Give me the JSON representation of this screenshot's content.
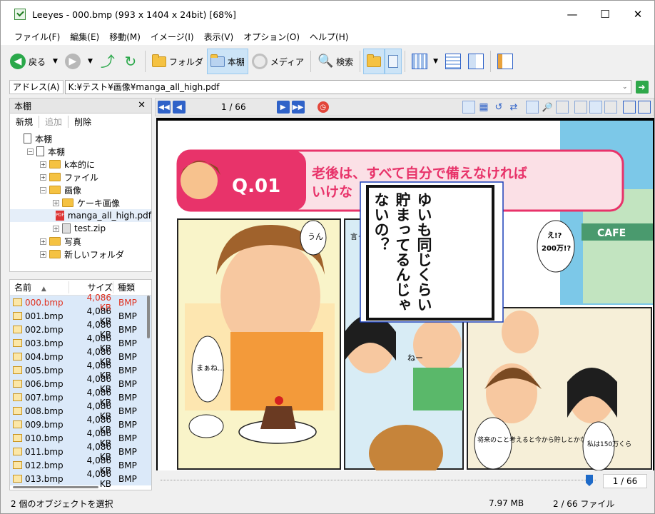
{
  "window": {
    "title": "Leeyes - 000.bmp (993 x 1404 x 24bit) [68%]"
  },
  "menu": [
    "ファイル(F)",
    "編集(E)",
    "移動(M)",
    "イメージ(I)",
    "表示(V)",
    "オプション(O)",
    "ヘルプ(H)"
  ],
  "toolbar": {
    "back": "戻る",
    "folder": "フォルダ",
    "bookshelf": "本棚",
    "media": "メディア",
    "search": "検索"
  },
  "address": {
    "label": "アドレス(A)",
    "value": "K:¥テスト¥画像¥manga_all_high.pdf"
  },
  "pane": {
    "title": "本棚",
    "btn_new": "新規",
    "btn_add": "追加",
    "btn_delete": "削除"
  },
  "tree": [
    {
      "label": "本棚",
      "icon": "doc",
      "indent": 0,
      "toggle": ""
    },
    {
      "label": "本棚",
      "icon": "doc",
      "indent": 1,
      "toggle": "−"
    },
    {
      "label": "k本的に",
      "icon": "folder",
      "indent": 2,
      "toggle": "+"
    },
    {
      "label": "ファイル",
      "icon": "folder",
      "indent": 2,
      "toggle": "+"
    },
    {
      "label": "画像",
      "icon": "folder",
      "indent": 2,
      "toggle": "−"
    },
    {
      "label": "ケーキ画像",
      "icon": "folder",
      "indent": 3,
      "toggle": "+"
    },
    {
      "label": "manga_all_high.pdf",
      "icon": "pdf",
      "indent": 3,
      "toggle": "",
      "selected": true
    },
    {
      "label": "test.zip",
      "icon": "zip",
      "indent": 3,
      "toggle": "+"
    },
    {
      "label": "写真",
      "icon": "folder",
      "indent": 2,
      "toggle": "+"
    },
    {
      "label": "新しいフォルダ",
      "icon": "folder",
      "indent": 2,
      "toggle": "+"
    }
  ],
  "filelist": {
    "headers": {
      "name": "名前",
      "size": "サイズ",
      "type": "種類"
    },
    "rows": [
      {
        "name": "000.bmp",
        "size": "4,086 KB",
        "type": "BMP",
        "current": true
      },
      {
        "name": "001.bmp",
        "size": "4,086 KB",
        "type": "BMP",
        "current": false
      },
      {
        "name": "002.bmp",
        "size": "4,086 KB",
        "type": "BMP",
        "current": false
      },
      {
        "name": "003.bmp",
        "size": "4,086 KB",
        "type": "BMP",
        "current": false
      },
      {
        "name": "004.bmp",
        "size": "4,086 KB",
        "type": "BMP",
        "current": false
      },
      {
        "name": "005.bmp",
        "size": "4,086 KB",
        "type": "BMP",
        "current": false
      },
      {
        "name": "006.bmp",
        "size": "4,086 KB",
        "type": "BMP",
        "current": false
      },
      {
        "name": "007.bmp",
        "size": "4,086 KB",
        "type": "BMP",
        "current": false
      },
      {
        "name": "008.bmp",
        "size": "4,086 KB",
        "type": "BMP",
        "current": false
      },
      {
        "name": "009.bmp",
        "size": "4,086 KB",
        "type": "BMP",
        "current": false
      },
      {
        "name": "010.bmp",
        "size": "4,086 KB",
        "type": "BMP",
        "current": false
      },
      {
        "name": "011.bmp",
        "size": "4,086 KB",
        "type": "BMP",
        "current": false
      },
      {
        "name": "012.bmp",
        "size": "4,086 KB",
        "type": "BMP",
        "current": false
      },
      {
        "name": "013.bmp",
        "size": "4,086 KB",
        "type": "BMP",
        "current": false
      }
    ]
  },
  "viewer": {
    "page_indicator": "1 / 66",
    "page_box": "1 / 66",
    "slider_fraction": 0.985,
    "manga": {
      "question_no": "Q.01",
      "headline_1": "老後は、すべて自分で備えなければ",
      "headline_2": "いけな",
      "bubble_un": "うん",
      "bubble_maane": "まぁね…",
      "bubble_itte": "言ってたしね!",
      "bubble_e": "え!?",
      "bubble_200": "200万!?",
      "bubble_nee": "ねー",
      "bubble_shourai": "将来のこと考えると今から貯しとかな",
      "bubble_watashi": "私は150万くら",
      "cafe": "CAFE",
      "popup_text": "ゆいも同じくらい貯まってるんじゃないの？"
    }
  },
  "status": {
    "selection": "2 個のオブジェクトを選択",
    "size": "7.97 MB",
    "files": "2 / 66 ファイル"
  }
}
